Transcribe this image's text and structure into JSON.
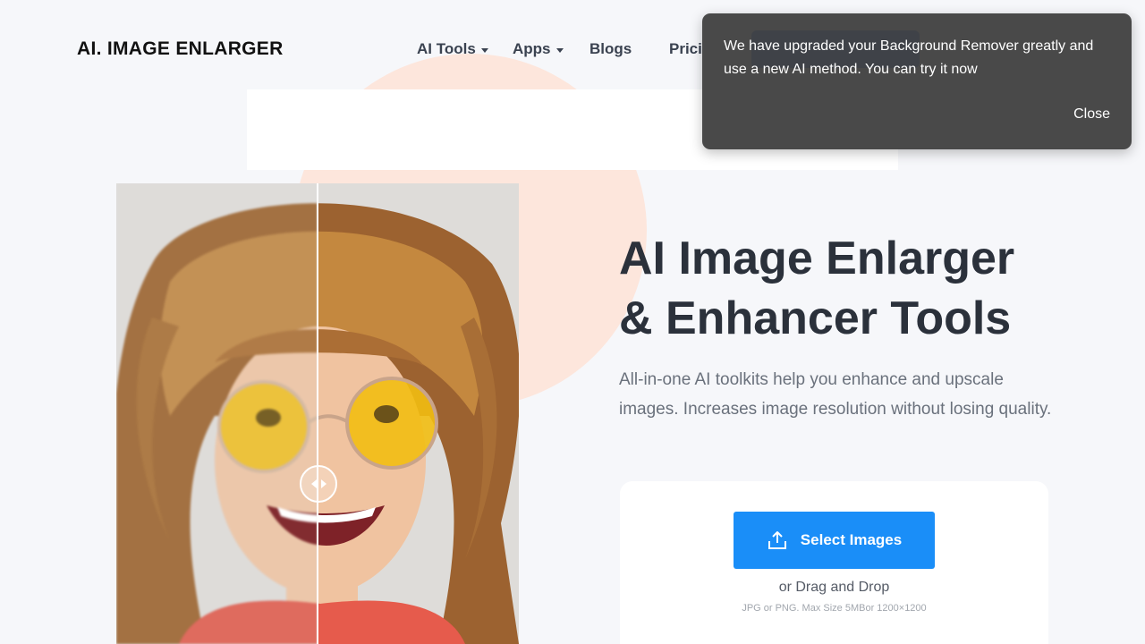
{
  "header": {
    "logo": "AI. IMAGE ENLARGER",
    "nav": {
      "ai_tools": "AI Tools",
      "apps": "Apps",
      "blogs": "Blogs",
      "pricing": "Prici"
    }
  },
  "hero": {
    "title_line1": "AI Image Enlarger",
    "title_line2": "& Enhancer Tools",
    "subtitle": "All-in-one AI toolkits help you enhance and upscale images. Increases image resolution without losing quality."
  },
  "upload": {
    "button_label": "Select Images",
    "drag_text": "or Drag and Drop",
    "hint": "JPG or PNG. Max Size 5MBor 1200×1200"
  },
  "toast": {
    "message": "We have upgraded your Background Remover greatly and use a new AI method. You can try it now",
    "close_label": "Close"
  },
  "colors": {
    "primary_button": "#1a8ef8",
    "nav_cta": "#1257e8",
    "accent_circle": "#fde6dc",
    "toast_bg": "#424242"
  },
  "icons": {
    "upload": "upload-icon",
    "compare_handle": "compare-arrows-icon"
  }
}
